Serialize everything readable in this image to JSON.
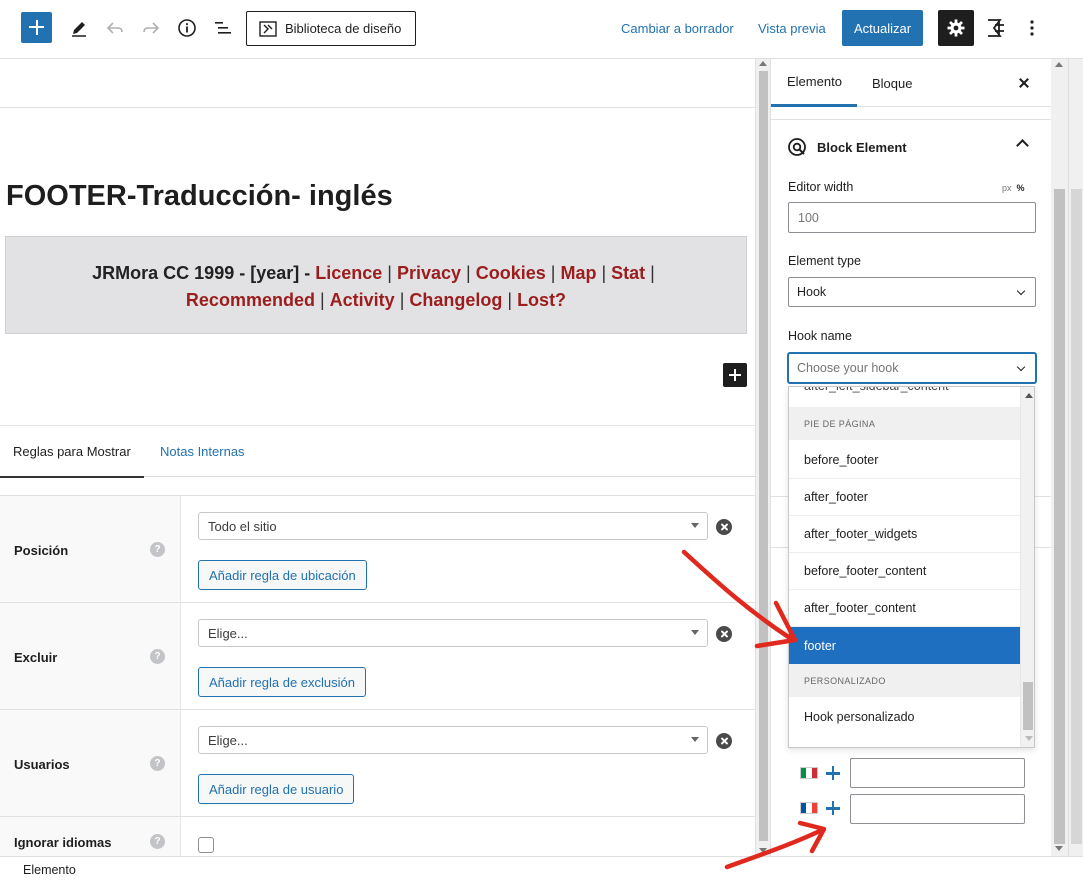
{
  "toolbar": {
    "add_icon": "plus-icon",
    "tools_icon": "pencil-icon",
    "undo_icon": "undo-icon",
    "redo_icon": "redo-icon",
    "info_icon": "info-icon",
    "list_view_icon": "list-view-icon",
    "library_label": "Biblioteca de diseño",
    "switch_draft_label": "Cambiar a borrador",
    "preview_label": "Vista previa",
    "update_label": "Actualizar",
    "settings_icon": "gear-icon",
    "plugin_icon": "generateblocks-icon",
    "more_icon": "more-vertical-icon",
    "accent_color": "#2271b1"
  },
  "editor": {
    "post_title": "FOOTER-Traducción- inglés",
    "footer_text": {
      "prefix": "JRMora CC 1999 - [year] -",
      "links_line1": [
        "Licence",
        "Privacy",
        "Cookies",
        "Map",
        "Stat"
      ],
      "links_line2": [
        "Recommended",
        "Activity",
        "Changelog",
        "Lost?"
      ],
      "link_color": "#9b1d1d",
      "box_color": "#e2e2e4"
    },
    "tabs": [
      {
        "label": "Reglas para Mostrar",
        "active": true
      },
      {
        "label": "Notas Internas",
        "active": false
      }
    ],
    "rules": [
      {
        "label": "Posición",
        "select_value": "Todo el sitio",
        "add_button": "Añadir regla de ubicación"
      },
      {
        "label": "Excluir",
        "select_value": "Elige...",
        "add_button": "Añadir regla de exclusión"
      },
      {
        "label": "Usuarios",
        "select_value": "Elige...",
        "add_button": "Añadir regla de usuario"
      },
      {
        "label": "Ignorar idiomas",
        "checked": false
      }
    ],
    "help_glyph": "?"
  },
  "sidebar": {
    "tabs": [
      {
        "label": "Elemento",
        "active": true
      },
      {
        "label": "Bloque",
        "active": false
      }
    ],
    "panel_title": "Block Element",
    "panel_icon": "block-element-icon",
    "editor_width_label": "Editor width",
    "units": [
      "px",
      "%"
    ],
    "editor_width_value": "100",
    "element_type_label": "Element type",
    "element_type_value": "Hook",
    "hook_name_label": "Hook name",
    "hook_name_placeholder": "Choose your hook",
    "translations": [
      {
        "flag": "flag-italy-icon",
        "colors": [
          "#009246",
          "#ffffff",
          "#ce2b37"
        ]
      },
      {
        "flag": "flag-france-icon",
        "colors": [
          "#0055a4",
          "#ffffff",
          "#ef4135"
        ]
      }
    ]
  },
  "hook_dropdown": {
    "partial_item": "after_left_sidebar_content",
    "groups": [
      {
        "label": "PIE DE PÁGINA",
        "items": [
          "before_footer",
          "after_footer",
          "after_footer_widgets",
          "before_footer_content",
          "after_footer_content",
          "footer"
        ]
      },
      {
        "label": "PERSONALIZADO",
        "items": [
          "Hook personalizado"
        ]
      }
    ],
    "selected": "footer",
    "selected_color": "#1e6fbf"
  },
  "footer_bar": {
    "breadcrumb": "Elemento"
  },
  "annotation_color": "#e0281e"
}
